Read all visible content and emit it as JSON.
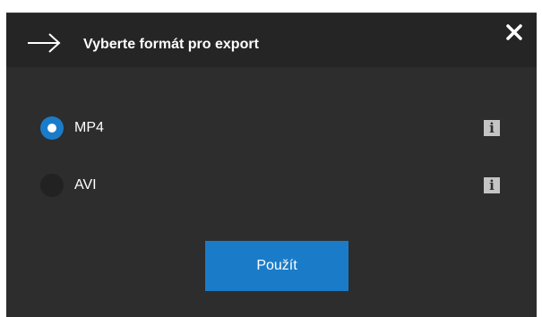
{
  "dialog": {
    "title": "Vyberte formát pro export",
    "header_icon": "arrow-right-icon",
    "close_icon": "close-icon"
  },
  "options": [
    {
      "label": "MP4",
      "selected": true,
      "info_icon": "info-icon",
      "info_glyph": "i"
    },
    {
      "label": "AVI",
      "selected": false,
      "info_icon": "info-icon",
      "info_glyph": "i"
    }
  ],
  "apply_button": {
    "label": "Použít"
  },
  "colors": {
    "background": "#2d2d2d",
    "header": "#252525",
    "accent": "#1a7cc9",
    "text": "#ffffff",
    "info_icon_bg": "#c4c4c4"
  }
}
